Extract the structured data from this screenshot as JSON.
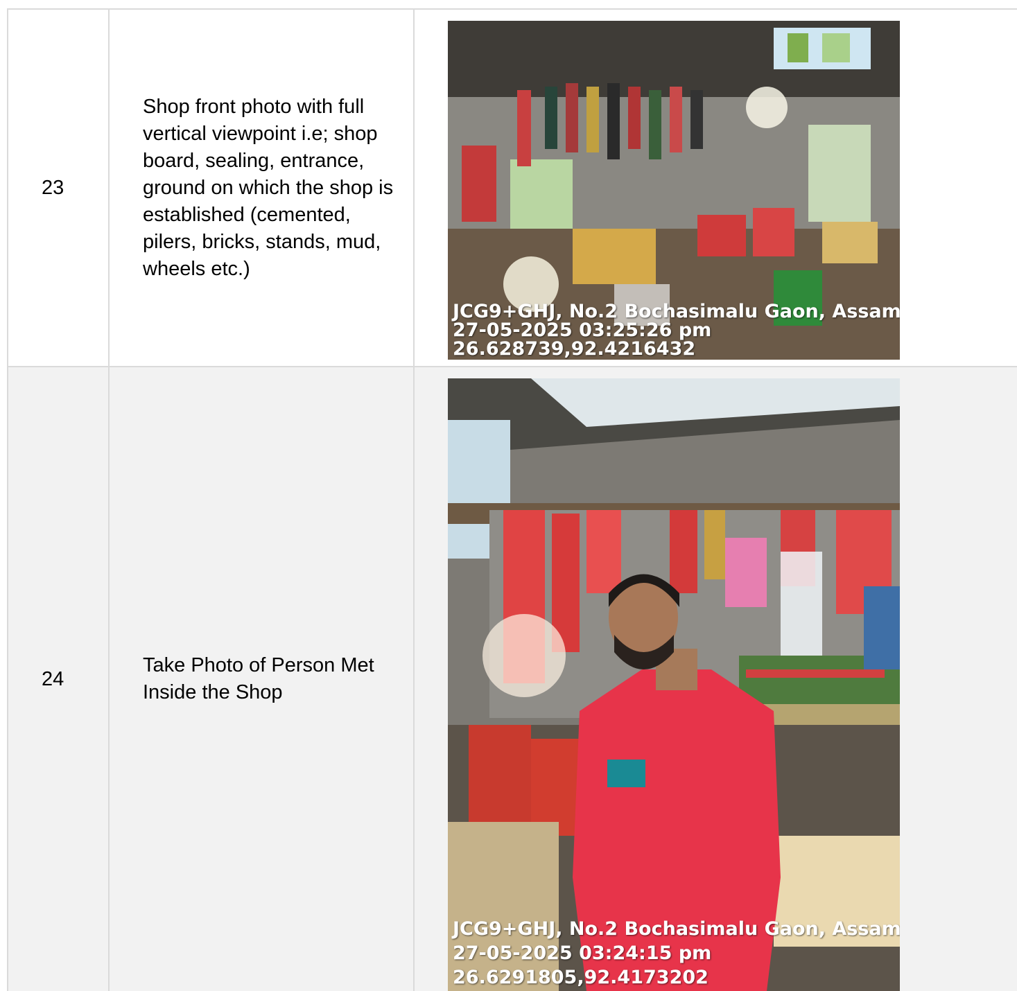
{
  "rows": [
    {
      "number": "23",
      "description": "Shop front photo with full vertical viewpoint i.e; shop board, sealing, entrance, ground on which the shop is established (cemented, pilers, bricks, stands, mud, wheels etc.)",
      "photo": {
        "location": "JCG9+GHJ, No.2 Bochasimalu Gaon, Assam",
        "datetime": "27-05-2025 03:25:26 pm",
        "coords": "26.628739,92.4216432"
      }
    },
    {
      "number": "24",
      "description": "Take Photo of Person Met Inside the Shop",
      "photo": {
        "location": "JCG9+GHJ, No.2 Bochasimalu Gaon, Assam",
        "datetime": "27-05-2025 03:24:15 pm",
        "coords": "26.6291805,92.4173202"
      }
    }
  ]
}
